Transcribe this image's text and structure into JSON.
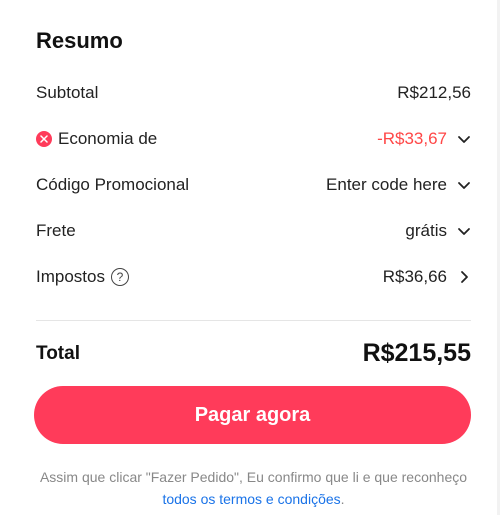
{
  "summary": {
    "title": "Resumo",
    "subtotal_label": "Subtotal",
    "subtotal_value": "R$212,56",
    "economy_label": "Economia de",
    "economy_value": "-R$33,67",
    "promo_label": "Código Promocional",
    "promo_value": "Enter code here",
    "shipping_label": "Frete",
    "shipping_value": "grátis",
    "taxes_label": "Impostos",
    "taxes_value": "R$36,66",
    "help_glyph": "?",
    "total_label": "Total",
    "total_value": "R$215,55",
    "pay_button_label": "Pagar agora",
    "disclaimer_text": "Assim que clicar \"Fazer Pedido\", Eu confirmo que li e que reconheço",
    "terms_link_text": "todos os termos e condições",
    "disclaimer_end": "."
  },
  "colors": {
    "accent": "#ff3b5a",
    "discount": "#ff4747",
    "link": "#1a73e8",
    "muted_text": "#888888"
  },
  "icons": {
    "savings": "savings-icon",
    "chevron_down": "chevron-down-icon",
    "chevron_right": "chevron-right-icon",
    "help": "help-circle-icon"
  }
}
